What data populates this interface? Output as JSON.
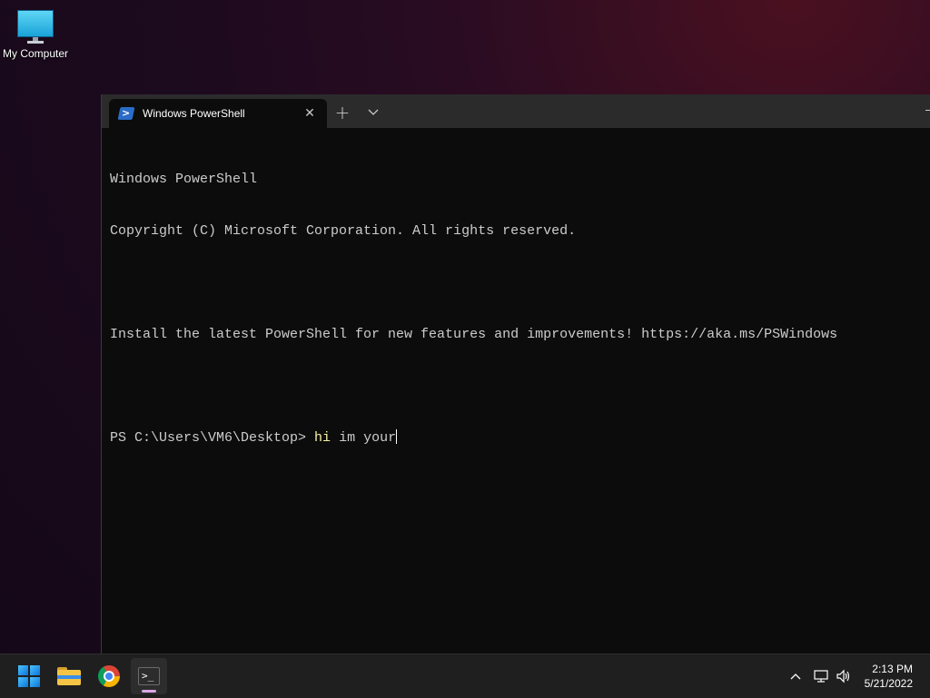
{
  "desktop": {
    "icons": [
      {
        "label": "My Computer",
        "icon": "monitor-icon"
      }
    ]
  },
  "terminal": {
    "tab": {
      "title": "Windows PowerShell",
      "icon": "powershell-icon"
    },
    "new_tab_glyph": "+",
    "close_glyph": "✕",
    "lines": [
      "Windows PowerShell",
      "Copyright (C) Microsoft Corporation. All rights reserved.",
      "",
      "Install the latest PowerShell for new features and improvements! https://aka.ms/PSWindows",
      ""
    ],
    "prompt": "PS C:\\Users\\VM6\\Desktop> ",
    "typed_command": "hi",
    "typed_args": " im your"
  },
  "taskbar": {
    "apps": [
      {
        "name": "start",
        "icon": "windows-logo-icon"
      },
      {
        "name": "file-explorer",
        "icon": "folder-icon"
      },
      {
        "name": "chrome",
        "icon": "chrome-icon"
      },
      {
        "name": "terminal",
        "icon": "terminal-icon",
        "active": true
      }
    ],
    "tray_icons": [
      "chevron-up-icon",
      "network-icon",
      "volume-icon"
    ],
    "time": "2:13 PM",
    "date": "5/21/2022"
  },
  "colors": {
    "terminal_bg": "#0c0c0c",
    "terminal_text": "#cccccc",
    "command_highlight": "#f9f1a5",
    "titlebar_bg": "#2b2b2b",
    "taskbar_bg": "#1f1f1f"
  }
}
